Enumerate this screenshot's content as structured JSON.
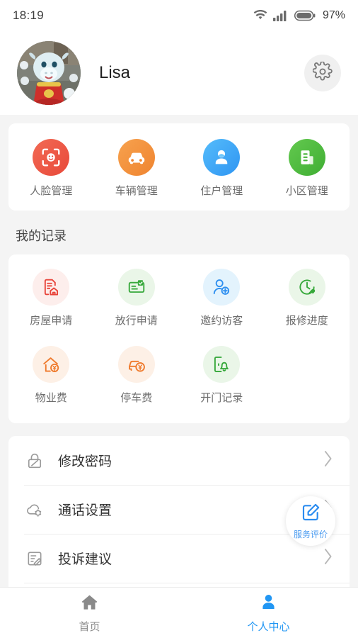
{
  "status_bar": {
    "time": "18:19",
    "battery_percent": "97%",
    "wifi_icon": "wifi-icon",
    "signal_icon": "signal-bars-icon",
    "battery_icon": "battery-icon"
  },
  "profile": {
    "name": "Lisa",
    "avatar_icon": "user-avatar",
    "settings_icon": "gear-icon"
  },
  "quick_actions": {
    "items": [
      {
        "label": "人脸管理",
        "icon": "face-scan-icon",
        "color": "#ef5f4c"
      },
      {
        "label": "车辆管理",
        "icon": "car-icon",
        "color": "#f4913c"
      },
      {
        "label": "住户管理",
        "icon": "resident-person-icon",
        "color": "#3ba5f7"
      },
      {
        "label": "小区管理",
        "icon": "community-document-icon",
        "color": "#4cba3c"
      }
    ]
  },
  "records": {
    "title": "我的记录",
    "items": [
      {
        "label": "房屋申请",
        "icon": "house-application-icon",
        "color": "#e8443a",
        "bg": "#fdeeec"
      },
      {
        "label": "放行申请",
        "icon": "release-pass-icon",
        "color": "#36a83a",
        "bg": "#eaf6e8"
      },
      {
        "label": "邀约访客",
        "icon": "invite-visitor-icon",
        "color": "#2e8ff0",
        "bg": "#e3f3fd"
      },
      {
        "label": "报修进度",
        "icon": "repair-progress-icon",
        "color": "#36a83a",
        "bg": "#eaf6e8"
      },
      {
        "label": "物业费",
        "icon": "property-fee-icon",
        "color": "#ef7a2c",
        "bg": "#fdf0e6"
      },
      {
        "label": "停车费",
        "icon": "parking-fee-icon",
        "color": "#ef7a2c",
        "bg": "#fdf0e6"
      },
      {
        "label": "开门记录",
        "icon": "door-open-record-icon",
        "color": "#36a83a",
        "bg": "#eaf6e8"
      }
    ]
  },
  "settings_list": {
    "items": [
      {
        "label": "修改密码",
        "icon": "lock-edit-icon"
      },
      {
        "label": "通话设置",
        "icon": "cloud-gear-icon"
      },
      {
        "label": "投诉建议",
        "icon": "form-edit-icon"
      }
    ]
  },
  "fab": {
    "label": "服务评价",
    "icon": "edit-square-icon",
    "color": "#2b8cf0"
  },
  "tabbar": {
    "tabs": [
      {
        "label": "首页",
        "icon": "home-icon",
        "active": false,
        "color": "#8a8a8a"
      },
      {
        "label": "个人中心",
        "icon": "person-icon",
        "active": true,
        "color": "#2196f3"
      }
    ]
  }
}
